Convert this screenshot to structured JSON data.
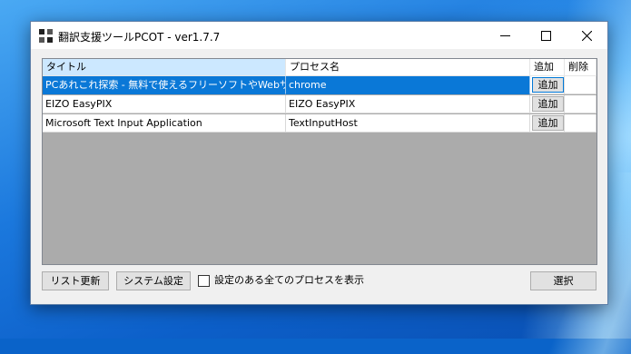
{
  "window": {
    "title": "翻訳支援ツールPCOT - ver1.7.7",
    "controls": {
      "minimize": "minimize",
      "maximize": "maximize",
      "close": "close"
    }
  },
  "list": {
    "columns": [
      "タイトル",
      "プロセス名",
      "追加",
      "削除"
    ],
    "rows": [
      {
        "title": "PCあれこれ探索 - 無料で使えるフリーソフトやWebサ...",
        "process": "chrome",
        "add": "追加"
      },
      {
        "title": "EIZO EasyPIX",
        "process": "EIZO EasyPIX",
        "add": "追加"
      },
      {
        "title": "Microsoft Text Input Application",
        "process": "TextInputHost",
        "add": "追加"
      }
    ]
  },
  "footer": {
    "refresh": "リスト更新",
    "settings": "システム設定",
    "show_all_label": "設定のある全てのプロセスを表示",
    "show_all_checked": false,
    "select": "選択"
  },
  "colors": {
    "selection": "#0a78d7",
    "header_active": "#cce8ff",
    "list_bg": "#ababab"
  }
}
